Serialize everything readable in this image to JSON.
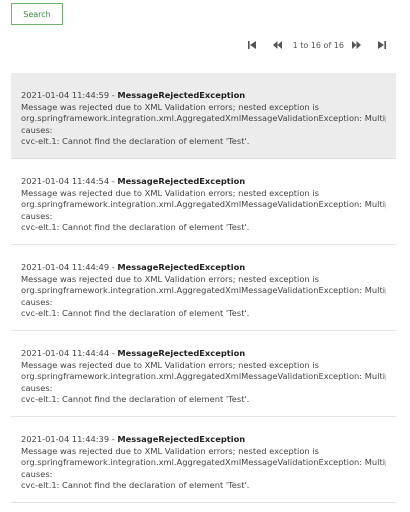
{
  "toolbar": {
    "search_label": "Search"
  },
  "pager": {
    "info": "1 to 16 of 16"
  },
  "messages": [
    {
      "timestamp": "2021-01-04 11:44:59",
      "separator": " - ",
      "type": "MessageRejectedException",
      "line1": "Message was rejected due to XML Validation errors; nested exception is",
      "line2": "org.springframework.integration.xml.AggregatedXmlMessageValidationException: Multiple",
      "line3": "causes:",
      "line4": "cvc-elt.1: Cannot find the declaration of element 'Test'."
    },
    {
      "timestamp": "2021-01-04 11:44:54",
      "separator": " - ",
      "type": "MessageRejectedException",
      "line1": "Message was rejected due to XML Validation errors; nested exception is",
      "line2": "org.springframework.integration.xml.AggregatedXmlMessageValidationException: Multiple",
      "line3": "causes:",
      "line4": "cvc-elt.1: Cannot find the declaration of element 'Test'."
    },
    {
      "timestamp": "2021-01-04 11:44:49",
      "separator": " - ",
      "type": "MessageRejectedException",
      "line1": "Message was rejected due to XML Validation errors; nested exception is",
      "line2": "org.springframework.integration.xml.AggregatedXmlMessageValidationException: Multiple",
      "line3": "causes:",
      "line4": "cvc-elt.1: Cannot find the declaration of element 'Test'."
    },
    {
      "timestamp": "2021-01-04 11:44:44",
      "separator": " - ",
      "type": "MessageRejectedException",
      "line1": "Message was rejected due to XML Validation errors; nested exception is",
      "line2": "org.springframework.integration.xml.AggregatedXmlMessageValidationException: Multiple",
      "line3": "causes:",
      "line4": "cvc-elt.1: Cannot find the declaration of element 'Test'."
    },
    {
      "timestamp": "2021-01-04 11:44:39",
      "separator": " - ",
      "type": "MessageRejectedException",
      "line1": "Message was rejected due to XML Validation errors; nested exception is",
      "line2": "org.springframework.integration.xml.AggregatedXmlMessageValidationException: Multiple",
      "line3": "causes:",
      "line4": "cvc-elt.1: Cannot find the declaration of element 'Test'."
    }
  ]
}
